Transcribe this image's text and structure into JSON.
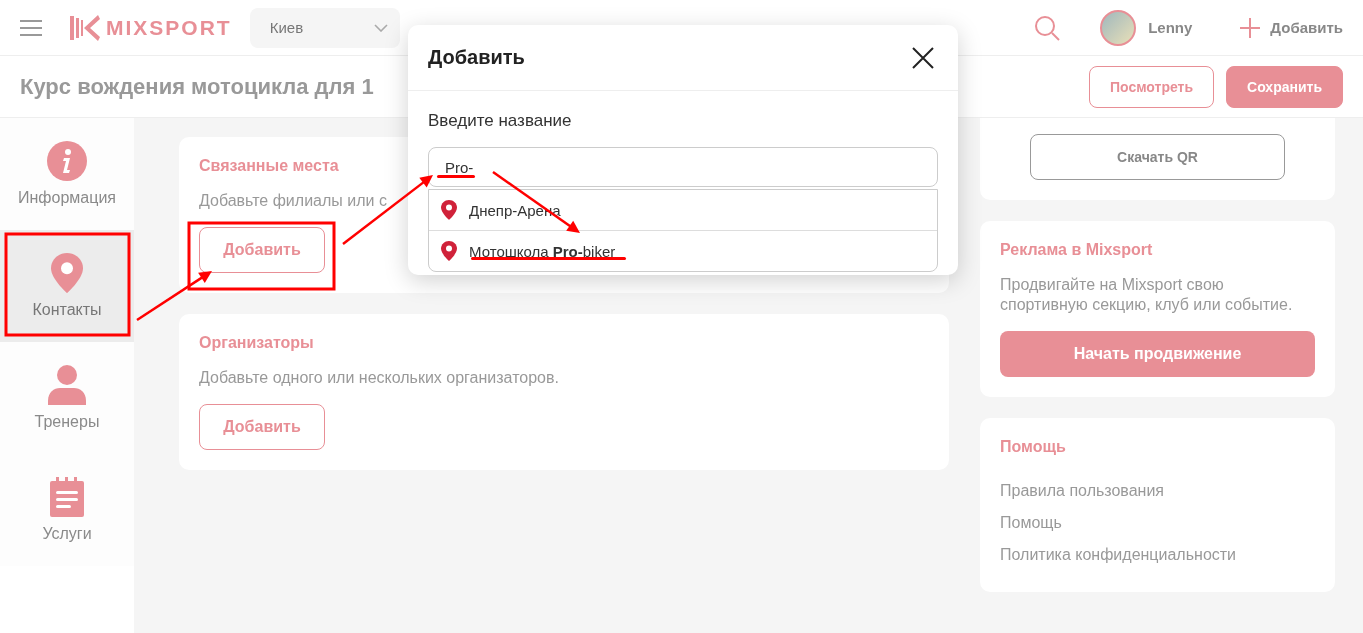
{
  "header": {
    "logo": "MIXSPORT",
    "city": "Киев",
    "user": "Lenny",
    "add_button": "Добавить"
  },
  "subheader": {
    "title": "Курс вождения мотоцикла для 1",
    "buttons": [
      {
        "label": "Посмотреть",
        "kind": "outline"
      },
      {
        "label": "Сохранить",
        "kind": "filled"
      }
    ]
  },
  "sidebar": {
    "items": [
      {
        "label": "Информация",
        "kind": "info",
        "selected": false
      },
      {
        "label": "Контакты",
        "kind": "pin",
        "selected": true
      },
      {
        "label": "Тренеры",
        "kind": "person",
        "selected": false
      },
      {
        "label": "Услуги",
        "kind": "notepad",
        "selected": false
      }
    ]
  },
  "sections": [
    {
      "title": "Связанные места",
      "description": "Добавьте филиалы или с",
      "button": "Добавить"
    },
    {
      "title": "Организаторы",
      "description": "Добавьте одного или нескольких организаторов.",
      "button": "Добавить"
    }
  ],
  "right_panel": {
    "qr_button": "Скачать QR",
    "promo": {
      "title": "Реклама в Mixsport",
      "text": "Продвигайте на Mixsport свою спортивную секцию, клуб или событие.",
      "button": "Начать продвижение"
    },
    "help": {
      "title": "Помощь",
      "links": [
        "Правила пользования",
        "Помощь",
        "Политика конфиденциальности"
      ]
    }
  },
  "modal": {
    "title": "Добавить",
    "label": "Введите название",
    "value": "Pro-",
    "suggestions": [
      "Днепр-Арена",
      "Мотошкола **Pro-**biker"
    ]
  }
}
